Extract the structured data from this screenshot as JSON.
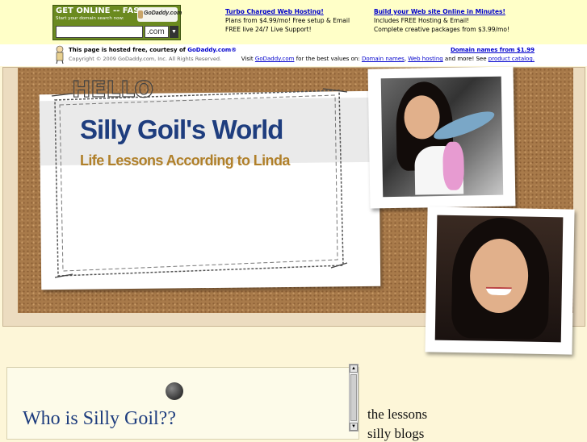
{
  "ad": {
    "gd_title": "GET ONLINE -- FAST!",
    "gd_sub": "Start your domain search now:",
    "gd_logo": "GoDaddy.com",
    "gd_tld": ".com",
    "col1_link": "Turbo Charged Web Hosting!",
    "col1_line1": "Plans from $4.99/mo! Free setup & Email",
    "col1_line2": "FREE live 24/7 Live Support!",
    "col2_link": "Build your Web site Online in Minutes!",
    "col2_line1": "Includes FREE Hosting & Email!",
    "col2_line2": "Complete creative packages from $3.99/mo!"
  },
  "hosted": {
    "title_prefix": "This page is hosted free, courtesy of ",
    "title_link": "GoDaddy.com®",
    "copyright": "Copyright © 2009 GoDaddy.com, Inc. All Rights Reserved.",
    "domain_names": "Domain names from $1.99",
    "visit_prefix": "Visit ",
    "visit_link": "GoDaddy.com",
    "visit_mid": " for the best values on: ",
    "link_domain": "Domain names",
    "comma": ", ",
    "link_hosting": "Web hosting",
    "visit_more": " and more! See ",
    "link_catalog": "product catalog."
  },
  "header": {
    "hello": "HELLO",
    "title": "Silly Goil's World",
    "tagline": "Life Lessons According to Linda"
  },
  "content": {
    "heading": "Who is Silly Goil??"
  },
  "nav": {
    "items": [
      "the lessons",
      "silly blogs"
    ]
  },
  "colors": {
    "title": "#1e3d7e",
    "tagline": "#b0802a",
    "ad_background": "#ffffc8",
    "link": "#0000cc"
  }
}
